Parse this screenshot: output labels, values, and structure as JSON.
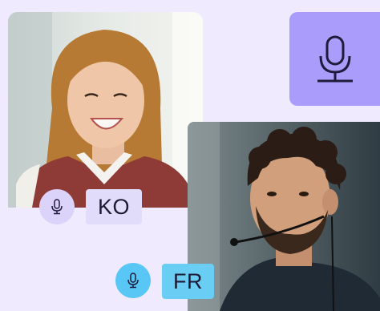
{
  "participants": [
    {
      "language_code": "KO",
      "mic_icon": "microphone-icon",
      "badge_color": "#e2dcfb",
      "mic_color": "#dcd3fb"
    },
    {
      "language_code": "FR",
      "mic_icon": "microphone-icon",
      "badge_color": "#69cdf4",
      "mic_color": "#58c7f5"
    }
  ],
  "microphone_tile": {
    "icon": "microphone-icon",
    "color": "#a99cfb"
  },
  "background_color": "#efeafd"
}
